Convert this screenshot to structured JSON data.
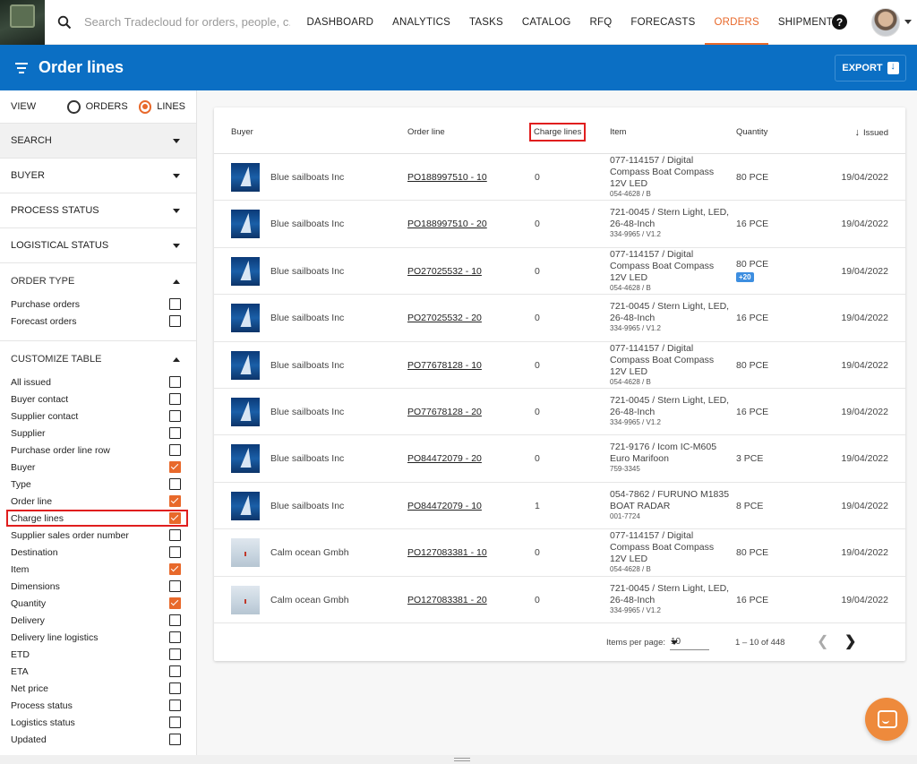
{
  "search": {
    "placeholder": "Search Tradecloud for orders, people, c..."
  },
  "nav": {
    "items": [
      {
        "label": "DASHBOARD"
      },
      {
        "label": "ANALYTICS"
      },
      {
        "label": "TASKS"
      },
      {
        "label": "CATALOG"
      },
      {
        "label": "RFQ"
      },
      {
        "label": "FORECASTS"
      },
      {
        "label": "ORDERS"
      },
      {
        "label": "SHIPMENTS"
      }
    ],
    "active": "ORDERS",
    "help_icon": "?"
  },
  "header": {
    "title": "Order lines",
    "export_label": "EXPORT"
  },
  "sidebar": {
    "view_label": "VIEW",
    "view_options": [
      {
        "label": "ORDERS",
        "selected": false
      },
      {
        "label": "LINES",
        "selected": true
      }
    ],
    "sections": [
      {
        "label": "SEARCH"
      },
      {
        "label": "BUYER"
      },
      {
        "label": "PROCESS STATUS"
      },
      {
        "label": "LOGISTICAL STATUS"
      }
    ],
    "order_type": {
      "label": "ORDER TYPE",
      "options": [
        {
          "label": "Purchase orders",
          "checked": false
        },
        {
          "label": "Forecast orders",
          "checked": false
        }
      ]
    },
    "customize": {
      "label": "CUSTOMIZE TABLE",
      "options": [
        {
          "label": "All issued",
          "checked": false
        },
        {
          "label": "Buyer contact",
          "checked": false
        },
        {
          "label": "Supplier contact",
          "checked": false
        },
        {
          "label": "Supplier",
          "checked": false
        },
        {
          "label": "Purchase order line row",
          "checked": false
        },
        {
          "label": "Buyer",
          "checked": true
        },
        {
          "label": "Type",
          "checked": false
        },
        {
          "label": "Order line",
          "checked": true
        },
        {
          "label": "Charge lines",
          "checked": true
        },
        {
          "label": "Supplier sales order number",
          "checked": false
        },
        {
          "label": "Destination",
          "checked": false
        },
        {
          "label": "Item",
          "checked": true
        },
        {
          "label": "Dimensions",
          "checked": false
        },
        {
          "label": "Quantity",
          "checked": true
        },
        {
          "label": "Delivery",
          "checked": false
        },
        {
          "label": "Delivery line logistics",
          "checked": false
        },
        {
          "label": "ETD",
          "checked": false
        },
        {
          "label": "ETA",
          "checked": false
        },
        {
          "label": "Net price",
          "checked": false
        },
        {
          "label": "Process status",
          "checked": false
        },
        {
          "label": "Logistics status",
          "checked": false
        },
        {
          "label": "Updated",
          "checked": false
        }
      ]
    }
  },
  "table": {
    "columns": {
      "buyer": "Buyer",
      "order_line": "Order line",
      "charge_lines": "Charge lines",
      "item": "Item",
      "quantity": "Quantity",
      "issued": "Issued"
    },
    "rows": [
      {
        "thumb": "sail",
        "buyer": "Blue sailboats Inc",
        "order_line": "PO188997510 - 10",
        "charge_lines": "0",
        "item_lines": [
          "077-114157 / Digital",
          "Compass Boat Compass",
          "12V LED"
        ],
        "item_sub": "054-4628 / B",
        "quantity": "80 PCE",
        "badge": "",
        "issued": "19/04/2022"
      },
      {
        "thumb": "sail",
        "buyer": "Blue sailboats Inc",
        "order_line": "PO188997510 - 20",
        "charge_lines": "0",
        "item_lines": [
          "721-0045 / Stern Light, LED,",
          "26-48-Inch"
        ],
        "item_sub": "334-9965 / V1.2",
        "quantity": "16 PCE",
        "badge": "",
        "issued": "19/04/2022"
      },
      {
        "thumb": "sail",
        "buyer": "Blue sailboats Inc",
        "order_line": "PO27025532 - 10",
        "charge_lines": "0",
        "item_lines": [
          "077-114157 / Digital",
          "Compass Boat Compass",
          "12V LED"
        ],
        "item_sub": "054-4628 / B",
        "quantity": "80 PCE",
        "badge": "+20",
        "issued": "19/04/2022"
      },
      {
        "thumb": "sail",
        "buyer": "Blue sailboats Inc",
        "order_line": "PO27025532 - 20",
        "charge_lines": "0",
        "item_lines": [
          "721-0045 / Stern Light, LED,",
          "26-48-Inch"
        ],
        "item_sub": "334-9965 / V1.2",
        "quantity": "16 PCE",
        "badge": "",
        "issued": "19/04/2022"
      },
      {
        "thumb": "sail",
        "buyer": "Blue sailboats Inc",
        "order_line": "PO77678128 - 10",
        "charge_lines": "0",
        "item_lines": [
          "077-114157 / Digital",
          "Compass Boat Compass",
          "12V LED"
        ],
        "item_sub": "054-4628 / B",
        "quantity": "80 PCE",
        "badge": "",
        "issued": "19/04/2022"
      },
      {
        "thumb": "sail",
        "buyer": "Blue sailboats Inc",
        "order_line": "PO77678128 - 20",
        "charge_lines": "0",
        "item_lines": [
          "721-0045 / Stern Light, LED,",
          "26-48-Inch"
        ],
        "item_sub": "334-9965 / V1.2",
        "quantity": "16 PCE",
        "badge": "",
        "issued": "19/04/2022"
      },
      {
        "thumb": "sail",
        "buyer": "Blue sailboats Inc",
        "order_line": "PO84472079 - 20",
        "charge_lines": "0",
        "item_lines": [
          "721-9176 / Icom IC-M605",
          "Euro Marifoon"
        ],
        "item_sub": "759-3345",
        "quantity": "3 PCE",
        "badge": "",
        "issued": "19/04/2022"
      },
      {
        "thumb": "sail",
        "buyer": "Blue sailboats Inc",
        "order_line": "PO84472079 - 10",
        "charge_lines": "1",
        "item_lines": [
          "054-7862 / FURUNO M1835",
          "BOAT RADAR"
        ],
        "item_sub": "001-7724",
        "quantity": "8 PCE",
        "badge": "",
        "issued": "19/04/2022"
      },
      {
        "thumb": "calm",
        "buyer": "Calm ocean Gmbh",
        "order_line": "PO127083381 - 10",
        "charge_lines": "0",
        "item_lines": [
          "077-114157 / Digital",
          "Compass Boat Compass",
          "12V LED"
        ],
        "item_sub": "054-4628 / B",
        "quantity": "80 PCE",
        "badge": "",
        "issued": "19/04/2022"
      },
      {
        "thumb": "calm",
        "buyer": "Calm ocean Gmbh",
        "order_line": "PO127083381 - 20",
        "charge_lines": "0",
        "item_lines": [
          "721-0045 / Stern Light, LED,",
          "26-48-Inch"
        ],
        "item_sub": "334-9965 / V1.2",
        "quantity": "16 PCE",
        "badge": "",
        "issued": "19/04/2022"
      }
    ]
  },
  "pagination": {
    "items_per_page_label": "Items per page:",
    "items_per_page": "10",
    "range": "1 – 10 of 448"
  },
  "colors": {
    "accent": "#e8692b",
    "header_blue": "#0b6fc4",
    "highlight": "#e01e1e"
  }
}
